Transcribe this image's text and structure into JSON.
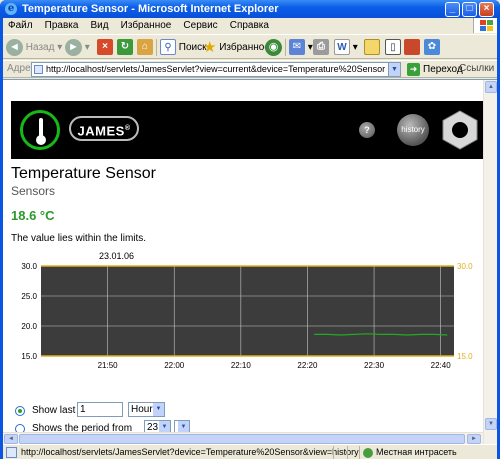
{
  "window": {
    "title": "Temperature Sensor - Microsoft Internet Explorer",
    "minimize": "_",
    "maximize": "□",
    "close": "×"
  },
  "menu": {
    "items": [
      "Файл",
      "Правка",
      "Вид",
      "Избранное",
      "Сервис",
      "Справка"
    ]
  },
  "toolbar": {
    "back_label": "Назад",
    "search_label": "Поиск",
    "favorites_label": "Избранное"
  },
  "address": {
    "label": "Адрес:",
    "url": "http://localhost/servlets/JamesServlet?view=current&device=Temperature%20Sensor",
    "go_label": "Переход",
    "links_label": "Ссылки"
  },
  "header": {
    "logo_text": "JAMES",
    "logo_mark": "®",
    "help_label": "?",
    "history_label": "history"
  },
  "page": {
    "title": "Temperature Sensor",
    "subtitle": "Sensors",
    "value": "18.6 °C",
    "status_text": "The value lies within the limits."
  },
  "chart_data": {
    "type": "line",
    "title": "23.01.06",
    "x": [
      "22:21",
      "22:23",
      "22:25",
      "22:27",
      "22:29",
      "22:31",
      "22:33",
      "22:35",
      "22:37",
      "22:39",
      "22:41"
    ],
    "series": [
      {
        "values": [
          18.6,
          18.6,
          18.5,
          18.6,
          18.7,
          18.6,
          18.6,
          18.5,
          18.6,
          18.6,
          18.5
        ]
      }
    ],
    "x_ticks": [
      "21:50",
      "22:00",
      "22:10",
      "22:20",
      "22:30",
      "22:40"
    ],
    "y_ticks": [
      "30.0",
      "25.0",
      "20.0",
      "15.0"
    ],
    "ylim": [
      15.0,
      30.0
    ],
    "upper_limit": 30.0,
    "lower_limit": 15.0,
    "upper_limit_label": "30.0",
    "lower_limit_label": "15.0",
    "xlim": [
      "21:40",
      "22:42"
    ],
    "grid": true,
    "colors": {
      "background": "#3c3c3c",
      "line": "#22aa22",
      "limit": "#e0b020",
      "grid": "#c8c8c8"
    }
  },
  "form": {
    "show_last_label": "Show last",
    "show_last_value": "1",
    "unit_value": "Hours",
    "period_label": "Shows the period from",
    "period_value": "23",
    "period_second_value": ""
  },
  "statusbar": {
    "text": "http://localhost/servlets/JamesServlet?device=Temperature%20Sensor&view=history",
    "zone": "Местная интрасеть"
  }
}
